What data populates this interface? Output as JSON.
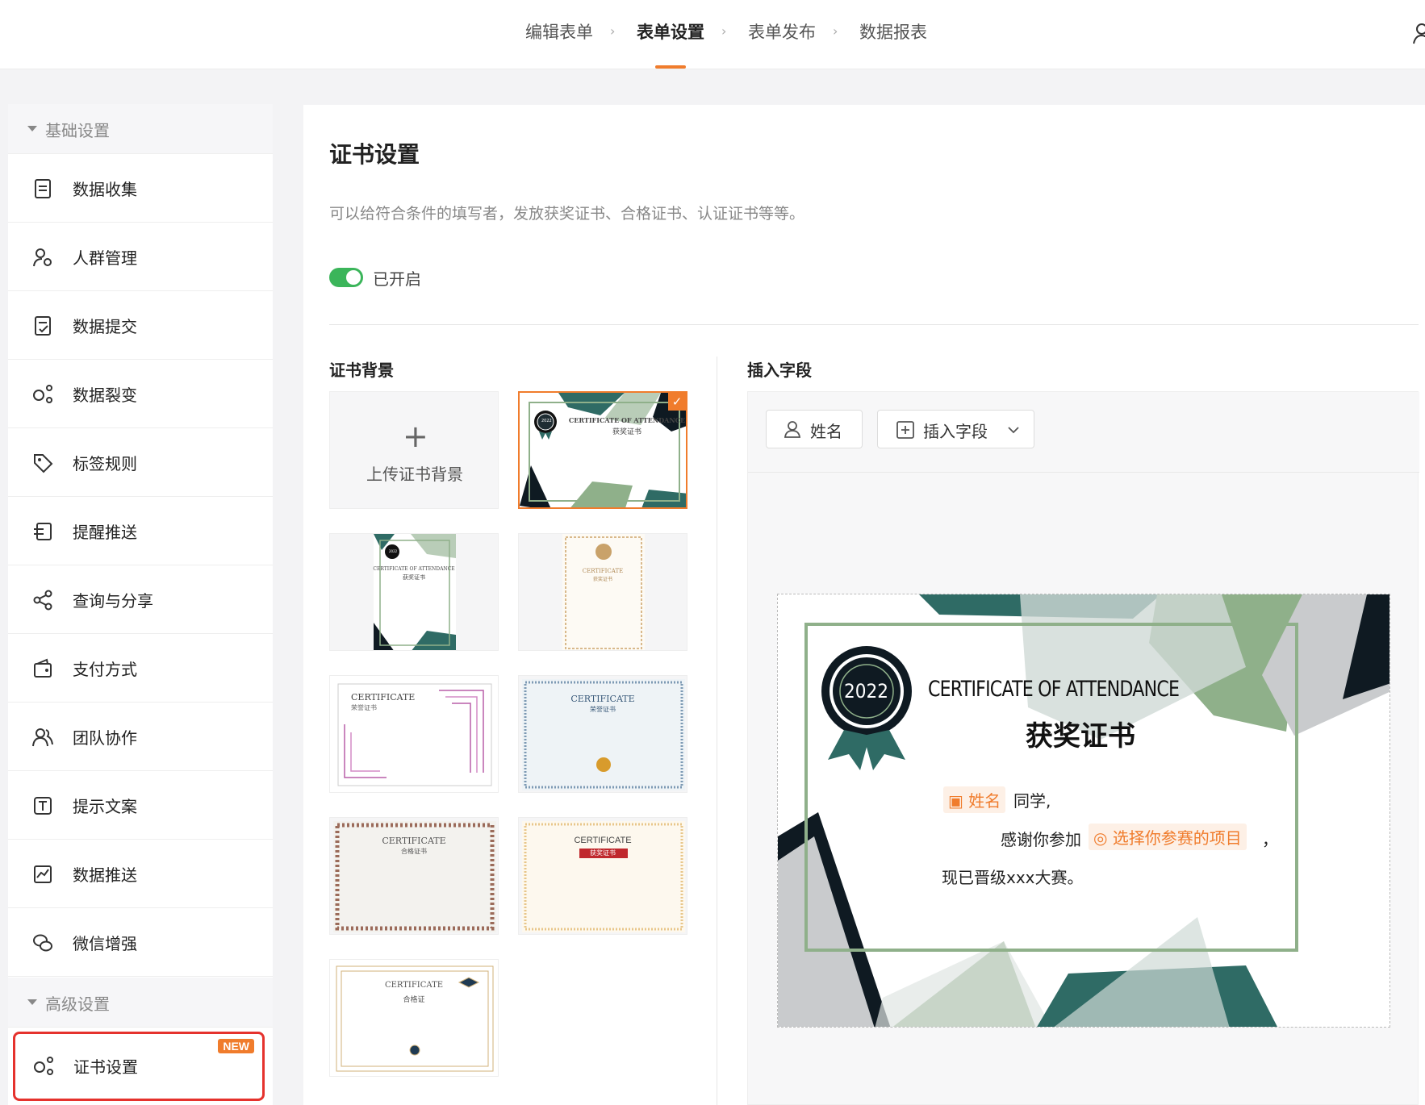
{
  "nav": {
    "steps": [
      "编辑表单",
      "表单设置",
      "表单发布",
      "数据报表"
    ],
    "active_step": "表单设置"
  },
  "sidebar": {
    "basic_label": "基础设置",
    "advanced_label": "高级设置",
    "items": [
      {
        "label": "数据收集",
        "icon": "document-icon"
      },
      {
        "label": "人群管理",
        "icon": "user-gear-icon"
      },
      {
        "label": "数据提交",
        "icon": "document-check-icon"
      },
      {
        "label": "数据裂变",
        "icon": "share-nodes-icon"
      },
      {
        "label": "标签规则",
        "icon": "tag-icon"
      },
      {
        "label": "提醒推送",
        "icon": "send-icon"
      },
      {
        "label": "查询与分享",
        "icon": "share-icon"
      },
      {
        "label": "支付方式",
        "icon": "wallet-icon"
      },
      {
        "label": "团队协作",
        "icon": "team-icon"
      },
      {
        "label": "提示文案",
        "icon": "text-icon"
      },
      {
        "label": "数据推送",
        "icon": "chart-icon"
      },
      {
        "label": "微信增强",
        "icon": "wechat-icon"
      }
    ],
    "advanced_item": {
      "label": "证书设置",
      "icon": "certificate-icon",
      "badge": "NEW"
    }
  },
  "main": {
    "title": "证书设置",
    "description": "可以给符合条件的填写者，发放获奖证书、合格证书、认证证书等等。",
    "toggle_label": "已开启",
    "toggle_on": true,
    "bg_section_title": "证书背景",
    "upload_label": "上传证书背景",
    "insert_section_title": "插入字段",
    "name_button": "姓名",
    "insert_button": "插入字段",
    "thumbnails": [
      {
        "title": "CERTIFICATE OF ATTENDANCE",
        "subtitle": "获奖证书",
        "badge": "2022",
        "selected": true
      },
      {
        "title": "CERTIFICATE OF ATTENDANCE",
        "subtitle": "获奖证书",
        "badge": "2022"
      },
      {
        "title": "CERTIFICATE",
        "subtitle": "获奖证书"
      },
      {
        "title": "CERTIFICATE",
        "subtitle": "荣誉证书"
      },
      {
        "title": "CERTIFICATE",
        "subtitle": "荣誉证书"
      },
      {
        "title": "CERTIFICATE",
        "subtitle": "合格证书"
      },
      {
        "title": "CERTIFICATE",
        "subtitle": "获奖证书"
      },
      {
        "title": "CERTIFICATE",
        "subtitle": "合格证"
      }
    ],
    "preview": {
      "badge_year": "2022",
      "title_en": "CERTIFICATE OF ATTENDANCE",
      "title_cn": "获奖证书",
      "name_chip": "姓名",
      "line1_suffix": "同学,",
      "line2_prefix": "感谢你参加",
      "project_chip": "选择你参赛的项目",
      "line2_suffix": "，",
      "line3": "现已晋级xxx大赛。"
    }
  },
  "colors": {
    "accent": "#f07c2c",
    "toggle": "#3bb55a",
    "highlight": "#e5322d",
    "cert_dark": "#2f6b65",
    "cert_green": "#8fb08a"
  }
}
